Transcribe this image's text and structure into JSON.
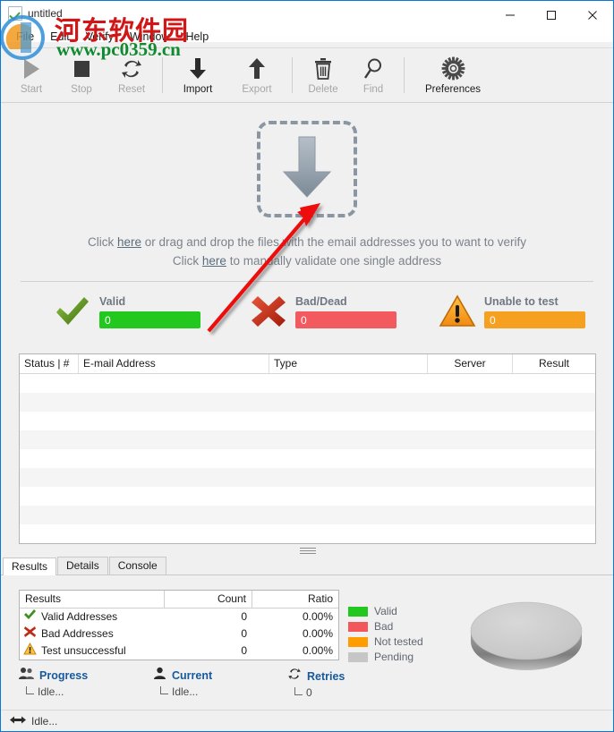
{
  "window": {
    "title": "untitled",
    "app_icon": "green-check-icon",
    "controls": {
      "minimize": "minimize-icon",
      "maximize": "maximize-icon",
      "close": "close-icon"
    }
  },
  "menubar": {
    "items": [
      {
        "label": "File"
      },
      {
        "label": "Edit"
      },
      {
        "label": "Verify"
      },
      {
        "label": "Window"
      },
      {
        "label": "Help"
      }
    ]
  },
  "toolbar": {
    "buttons": [
      {
        "label": "Start",
        "icon": "play-icon",
        "enabled": false
      },
      {
        "label": "Stop",
        "icon": "stop-icon",
        "enabled": false
      },
      {
        "label": "Reset",
        "icon": "refresh-icon",
        "enabled": false
      },
      {
        "label": "Import",
        "icon": "arrow-down-icon",
        "enabled": true
      },
      {
        "label": "Export",
        "icon": "arrow-up-icon",
        "enabled": false
      },
      {
        "label": "Delete",
        "icon": "trash-icon",
        "enabled": false
      },
      {
        "label": "Find",
        "icon": "magnifier-icon",
        "enabled": false
      },
      {
        "label": "Preferences",
        "icon": "gear-icon",
        "enabled": true
      }
    ]
  },
  "dropzone": {
    "icon": "download-arrow-icon",
    "line1_prefix": "Click ",
    "line1_link": "here",
    "line1_suffix": " or drag and drop the files with the email addresses you to want to verify",
    "line2_prefix": "Click ",
    "line2_link": "here",
    "line2_suffix": " to manually validate one single address"
  },
  "counters": [
    {
      "title": "Valid",
      "value": "0",
      "color": "#22c81e",
      "icon": "check-mark-icon"
    },
    {
      "title": "Bad/Dead",
      "value": "0",
      "color": "#f25a5f",
      "icon": "red-x-icon"
    },
    {
      "title": "Unable to test",
      "value": "0",
      "color": "#f6a020",
      "icon": "warning-triangle-icon"
    }
  ],
  "grid": {
    "columns": [
      {
        "label": "Status | #"
      },
      {
        "label": "E-mail Address"
      },
      {
        "label": "Type"
      },
      {
        "label": "Server"
      },
      {
        "label": "Result"
      }
    ],
    "rows": []
  },
  "tabs": [
    {
      "label": "Results",
      "active": true
    },
    {
      "label": "Details",
      "active": false
    },
    {
      "label": "Console",
      "active": false
    }
  ],
  "results_table": {
    "headers": {
      "name": "Results",
      "count": "Count",
      "ratio": "Ratio"
    },
    "rows": [
      {
        "icon": "green-check-icon",
        "label": "Valid Addresses",
        "count": "0",
        "ratio": "0.00%"
      },
      {
        "icon": "red-x-icon",
        "label": "Bad Addresses",
        "count": "0",
        "ratio": "0.00%"
      },
      {
        "icon": "warning-triangle-icon",
        "label": "Test unsuccessful",
        "count": "0",
        "ratio": "0.00%"
      }
    ]
  },
  "legend": [
    {
      "label": "Valid",
      "color": "#22c81e"
    },
    {
      "label": "Bad",
      "color": "#f2575c"
    },
    {
      "label": "Not tested",
      "color": "#ff9d00"
    },
    {
      "label": "Pending",
      "color": "#c6c6c6"
    }
  ],
  "chart_data": {
    "type": "pie",
    "title": "",
    "categories": [
      "Valid",
      "Bad",
      "Not tested",
      "Pending"
    ],
    "values": [
      0,
      0,
      0,
      0
    ],
    "colors": [
      "#22c81e",
      "#f2575c",
      "#ff9d00",
      "#c6c6c6"
    ],
    "legend_position": "left",
    "note": "Empty state: entire 3D pie rendered in Pending gray (no data)"
  },
  "progress": [
    {
      "title": "Progress",
      "icon": "users-icon",
      "value": "Idle..."
    },
    {
      "title": "Current",
      "icon": "user-icon",
      "value": "Idle..."
    },
    {
      "title": "Retries",
      "icon": "refresh-icon",
      "value": "0"
    }
  ],
  "statusbar": {
    "icon": "network-transfer-icon",
    "text": "Idle..."
  },
  "watermark": {
    "chinese": "河东软件园",
    "url": "www.pc0359.cn"
  }
}
